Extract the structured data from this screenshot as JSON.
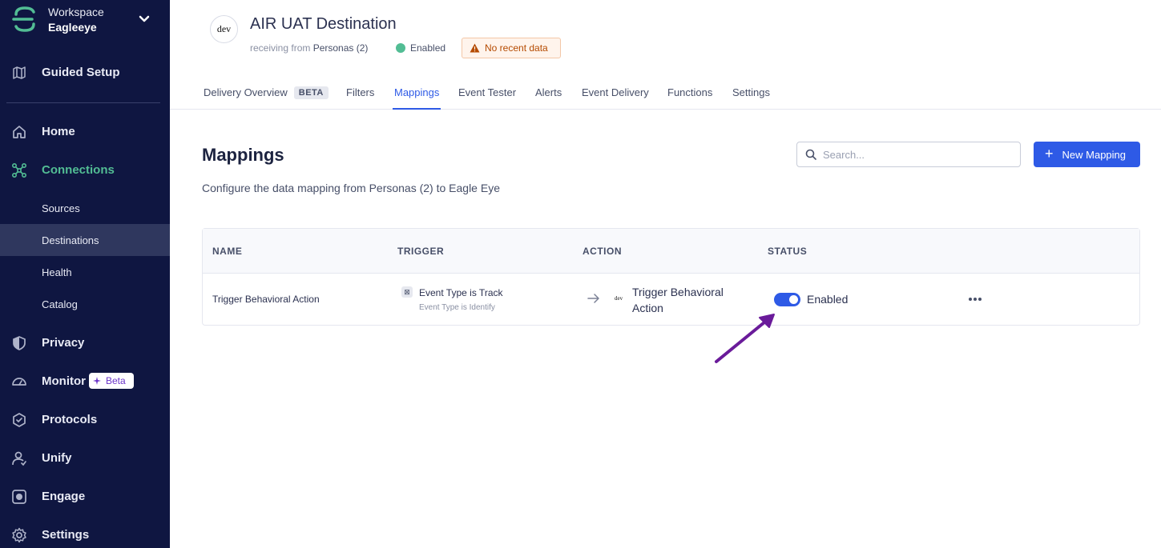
{
  "workspace": {
    "label": "Workspace",
    "name": "Eagleeye"
  },
  "sidebar": {
    "top_items": [
      {
        "label": "Guided Setup",
        "icon": "map-icon"
      }
    ],
    "items": [
      {
        "label": "Home",
        "icon": "home-icon"
      },
      {
        "label": "Connections",
        "icon": "connections-icon",
        "active": true
      },
      {
        "label": "Privacy",
        "icon": "shield-icon"
      },
      {
        "label": "Monitor",
        "icon": "gauge-icon",
        "badge": "Beta"
      },
      {
        "label": "Protocols",
        "icon": "protocols-icon"
      },
      {
        "label": "Unify",
        "icon": "unify-icon"
      },
      {
        "label": "Engage",
        "icon": "engage-icon"
      },
      {
        "label": "Settings",
        "icon": "gear-icon"
      }
    ],
    "sub_items": [
      {
        "label": "Sources"
      },
      {
        "label": "Destinations",
        "active": true
      },
      {
        "label": "Health"
      },
      {
        "label": "Catalog"
      }
    ]
  },
  "header": {
    "logo_text": "dev",
    "title": "AIR UAT Destination",
    "receiving_prefix": "receiving from",
    "receiving_source": "Personas (2)",
    "status": "Enabled",
    "warning": "No recent data"
  },
  "tabs": [
    {
      "label": "Delivery Overview",
      "badge": "BETA"
    },
    {
      "label": "Filters"
    },
    {
      "label": "Mappings",
      "active": true
    },
    {
      "label": "Event Tester"
    },
    {
      "label": "Alerts"
    },
    {
      "label": "Event Delivery"
    },
    {
      "label": "Functions"
    },
    {
      "label": "Settings"
    }
  ],
  "main": {
    "title": "Mappings",
    "description": "Configure the data mapping from Personas (2) to Eagle Eye",
    "search_placeholder": "Search...",
    "new_button": "New Mapping"
  },
  "table": {
    "columns": [
      "NAME",
      "TRIGGER",
      "ACTION",
      "STATUS"
    ],
    "rows": [
      {
        "name": "Trigger Behavioral Action",
        "trigger_main": "Event Type is Track",
        "trigger_sub": "Event Type is Identify",
        "action_logo": "dev",
        "action": "Trigger Behavioral Action",
        "status": "Enabled",
        "enabled": true
      }
    ]
  },
  "colors": {
    "sidebar_bg": "#0f1641",
    "accent": "#2e5ae6",
    "active_green": "#52bd94",
    "annotation_arrow": "#6a1b9a"
  }
}
